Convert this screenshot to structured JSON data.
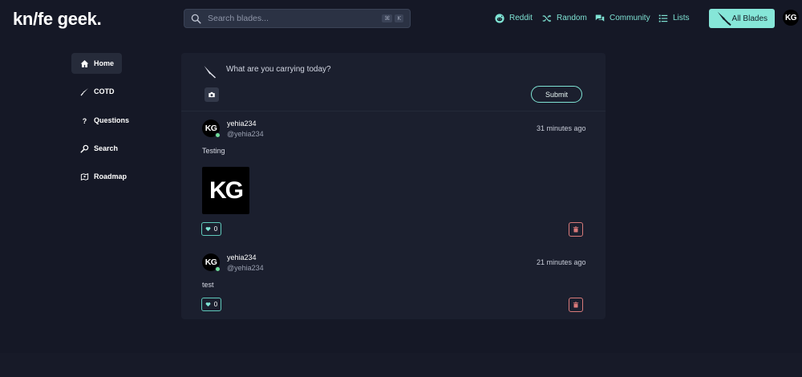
{
  "header": {
    "logo_text": "kn/fe geek.",
    "search": {
      "placeholder": "Search blades...",
      "shortcut_keys": [
        "⌘",
        "K"
      ]
    },
    "nav": [
      {
        "label": "Reddit",
        "icon": "reddit-icon"
      },
      {
        "label": "Random",
        "icon": "shuffle-icon"
      },
      {
        "label": "Community",
        "icon": "chat-icon"
      },
      {
        "label": "Lists",
        "icon": "list-icon"
      }
    ],
    "all_blades_label": "All Blades",
    "avatar_initials": "KG"
  },
  "sidebar": {
    "items": [
      {
        "label": "Home",
        "icon": "home-icon",
        "active": true
      },
      {
        "label": "COTD",
        "icon": "knife-icon",
        "active": false
      },
      {
        "label": "Questions",
        "icon": "question-icon",
        "active": false
      },
      {
        "label": "Search",
        "icon": "magnifier-icon",
        "active": false
      },
      {
        "label": "Roadmap",
        "icon": "roadmap-icon",
        "active": false
      }
    ]
  },
  "composer": {
    "prompt": "What are you carrying today?",
    "submit_label": "Submit"
  },
  "posts": [
    {
      "avatar_initials": "KG",
      "name": "yehia234",
      "handle": "@yehia234",
      "time": "31 minutes ago",
      "body": "Testing",
      "image_text": "KG",
      "likes": "0"
    },
    {
      "avatar_initials": "KG",
      "name": "yehia234",
      "handle": "@yehia234",
      "time": "21 minutes ago",
      "body": "test",
      "likes": "0"
    }
  ],
  "colors": {
    "background": "#151826",
    "card": "#1b1f2e",
    "accent": "#7fe3d4",
    "accent_button": "#86e6d8",
    "danger": "#d97a7a",
    "online": "#6fdc9a"
  }
}
